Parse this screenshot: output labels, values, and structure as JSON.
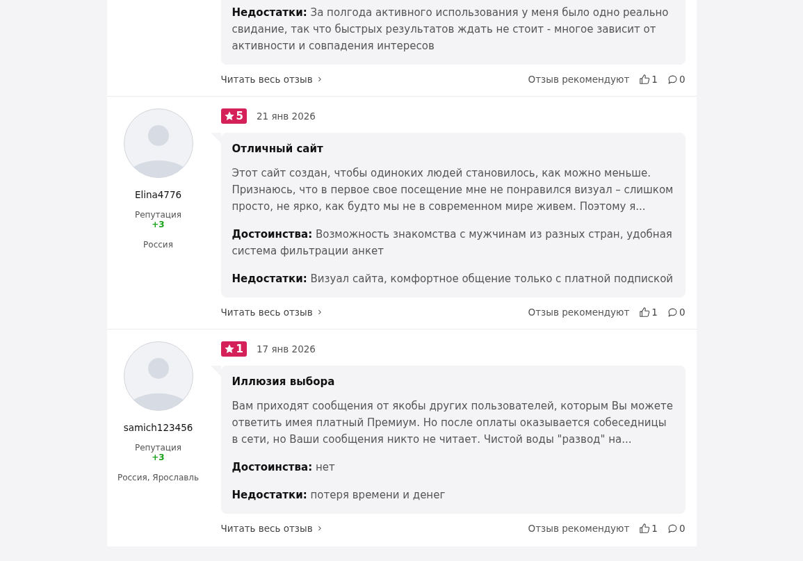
{
  "reviews": [
    {
      "paragraphs": [
        "**Недостатки:** За полгода активного использования у меня было одно реально свидание, так что быстрых результатов ждать не стоит - многое зависит от активности и совпадения интересов"
      ],
      "read_more": "Читать весь отзыв",
      "recommend_label": "Отзыв рекомендуют",
      "likes": "1",
      "comments": "0"
    },
    {
      "user": {
        "name": "Elina4776",
        "reputation_label": "Репутация",
        "reputation": "+3",
        "location": "Россия"
      },
      "rating": "5",
      "date": "21 янв 2026",
      "title": "Отличный сайт",
      "paragraphs": [
        "Этот сайт создан, чтобы одиноких людей становилось, как можно меньше. Признаюсь, что в первое свое посещение мне не понравился визуал – слишком просто, не ярко, как будто мы не в современном мире живем. Поэтому я...",
        "**Достоинства:** Возможность знакомства с мужчинам из разных стран, удобная система фильтрации анкет",
        "**Недостатки:** Визуал сайта, комфортное общение только с платной подпиской"
      ],
      "read_more": "Читать весь отзыв",
      "recommend_label": "Отзыв рекомендуют",
      "likes": "1",
      "comments": "0"
    },
    {
      "user": {
        "name": "samich123456",
        "reputation_label": "Репутация",
        "reputation": "+3",
        "location": "Россия, Ярославль"
      },
      "rating": "1",
      "date": "17 янв 2026",
      "title": "Иллюзия выбора",
      "paragraphs": [
        "Вам приходят сообщения от якобы других пользователей, которым Вы можете ответить имея платный Премиум. Но после оплаты оказывается собеседницы в сети, но Ваши сообщения никто не читает. Чистой воды \"развод\" на...",
        "**Достоинства:** нет",
        "**Недостатки:** потеря времени и денег"
      ],
      "read_more": "Читать весь отзыв",
      "recommend_label": "Отзыв рекомендуют",
      "likes": "1",
      "comments": "0"
    }
  ]
}
